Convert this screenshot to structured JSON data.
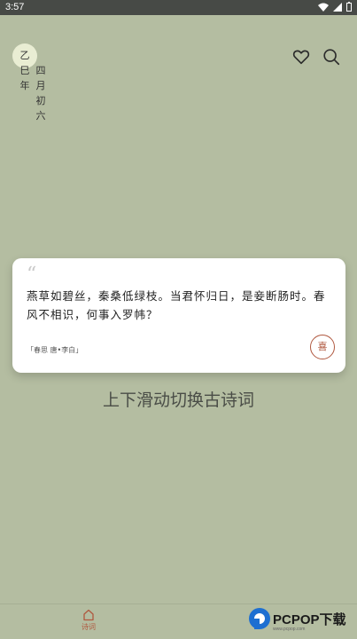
{
  "status_bar": {
    "time": "3:57"
  },
  "date": {
    "col1": "乙巳年",
    "col2": "四月初六"
  },
  "header": {
    "heart_icon": "heart-icon",
    "search_icon": "search-icon"
  },
  "poem_card": {
    "quote_mark": "“",
    "text": "燕草如碧丝，秦桑低绿枝。当君怀归日，是妾断肠时。春风不相识，何事入罗帏？",
    "source": "「春思 唐•李白」",
    "seal_char": "喜"
  },
  "hint": "上下滑动切换古诗词",
  "bottom_nav": {
    "tab_label": "诗词"
  },
  "watermark": {
    "brand": "PCPOP下载",
    "sub": "www.pcpop.com"
  },
  "colors": {
    "background": "#b4bda1",
    "accent": "#b0583f",
    "card": "#ffffff"
  }
}
